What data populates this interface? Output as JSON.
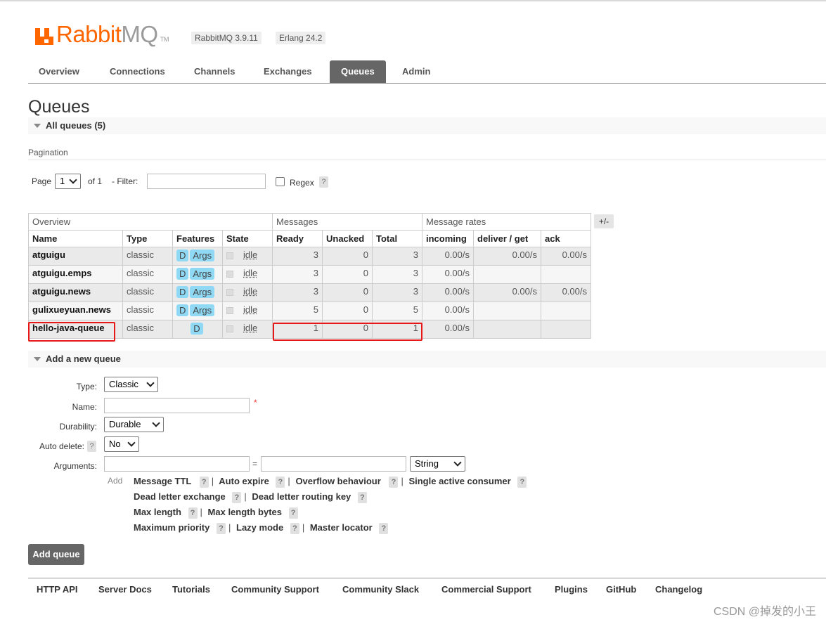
{
  "header": {
    "logo_rabbit": "Rabbit",
    "logo_mq": "MQ",
    "logo_tm": "TM",
    "version": "RabbitMQ 3.9.11",
    "erlang": "Erlang 24.2"
  },
  "tabs": [
    {
      "label": "Overview"
    },
    {
      "label": "Connections"
    },
    {
      "label": "Channels"
    },
    {
      "label": "Exchanges"
    },
    {
      "label": "Queues"
    },
    {
      "label": "Admin"
    }
  ],
  "page_title": "Queues",
  "all_queues_label": "All queues (5)",
  "pagination": {
    "title": "Pagination",
    "page_label": "Page",
    "page_value": "1",
    "of_label": "of 1",
    "filter_label": "- Filter:",
    "regex_label": "Regex",
    "help": "?"
  },
  "table": {
    "groups": [
      "Overview",
      "Messages",
      "Message rates"
    ],
    "columns": [
      "Name",
      "Type",
      "Features",
      "State",
      "Ready",
      "Unacked",
      "Total",
      "incoming",
      "deliver / get",
      "ack"
    ],
    "plusminus": "+/-",
    "rows": [
      {
        "name": "atguigu",
        "type": "classic",
        "feat_d": "D",
        "feat_args": "Args",
        "state": "idle",
        "ready": "3",
        "unacked": "0",
        "total": "3",
        "incoming": "0.00/s",
        "deliver": "0.00/s",
        "ack": "0.00/s"
      },
      {
        "name": "atguigu.emps",
        "type": "classic",
        "feat_d": "D",
        "feat_args": "Args",
        "state": "idle",
        "ready": "3",
        "unacked": "0",
        "total": "3",
        "incoming": "0.00/s",
        "deliver": "",
        "ack": ""
      },
      {
        "name": "atguigu.news",
        "type": "classic",
        "feat_d": "D",
        "feat_args": "Args",
        "state": "idle",
        "ready": "3",
        "unacked": "0",
        "total": "3",
        "incoming": "0.00/s",
        "deliver": "0.00/s",
        "ack": "0.00/s"
      },
      {
        "name": "gulixueyuan.news",
        "type": "classic",
        "feat_d": "D",
        "feat_args": "Args",
        "state": "idle",
        "ready": "5",
        "unacked": "0",
        "total": "5",
        "incoming": "0.00/s",
        "deliver": "",
        "ack": ""
      },
      {
        "name": "hello-java-queue",
        "type": "classic",
        "feat_d": "D",
        "feat_args": "",
        "state": "idle",
        "ready": "1",
        "unacked": "0",
        "total": "1",
        "incoming": "0.00/s",
        "deliver": "",
        "ack": ""
      }
    ]
  },
  "add_queue": {
    "section_label": "Add a new queue",
    "type_label": "Type:",
    "type_value": "Classic",
    "name_label": "Name:",
    "required": "*",
    "durability_label": "Durability:",
    "durability_value": "Durable",
    "auto_delete_label": "Auto delete:",
    "auto_delete_value": "No",
    "arguments_label": "Arguments:",
    "equals": "=",
    "arg_type_value": "String",
    "add_label": "Add",
    "hints": {
      "message_ttl": "Message TTL",
      "auto_expire": "Auto expire",
      "overflow": "Overflow behaviour",
      "single_active": "Single active consumer",
      "dlx": "Dead letter exchange",
      "dlrk": "Dead letter routing key",
      "max_length": "Max length",
      "max_length_bytes": "Max length bytes",
      "max_priority": "Maximum priority",
      "lazy_mode": "Lazy mode",
      "master_locator": "Master locator"
    },
    "separator": "|",
    "button": "Add queue"
  },
  "footer": [
    "HTTP API",
    "Server Docs",
    "Tutorials",
    "Community Support",
    "Community Slack",
    "Commercial Support",
    "Plugins",
    "GitHub",
    "Changelog"
  ],
  "watermark": "CSDN @掉发的小王"
}
